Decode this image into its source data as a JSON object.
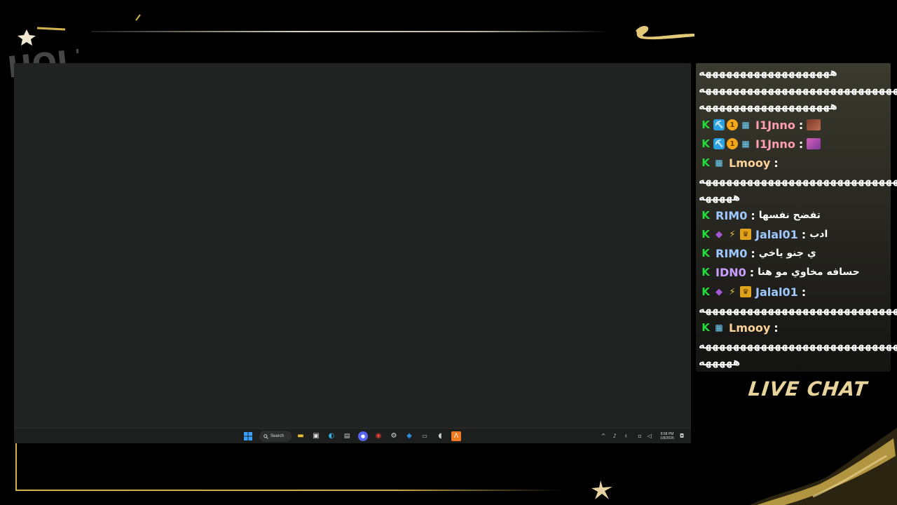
{
  "overlay": {
    "logo_text": "HOLZ",
    "live_chat_label": "LIVE CHAT",
    "accent_gold": "#d4b24e"
  },
  "taskbar": {
    "search_label": "Search",
    "clock_time": "8:58 PM",
    "clock_date": "1/8/2026",
    "lang": "ع",
    "icons": [
      "windows-start-icon",
      "search-icon",
      "file-explorer-icon",
      "store-icon",
      "edge-icon",
      "task-app-icon",
      "discord-icon",
      "chrome-icon",
      "steam-icon",
      "steam-blue-icon",
      "keyboard-icon",
      "app-icon",
      "orange-app-icon"
    ]
  },
  "chat": {
    "messages": [
      {
        "id": "m1",
        "lines": [
          "هههههههههههههههههههه",
          "هههههههههههههههههههههههههههههه",
          "هههههههههههههههههههه"
        ]
      },
      {
        "id": "m2",
        "user": "I1Jnno",
        "color": "#ff9fb0",
        "badges": [
          "kick",
          "pickaxe",
          "one",
          "og"
        ],
        "emote": "emote-brown"
      },
      {
        "id": "m3",
        "user": "I1Jnno",
        "color": "#ff9fb0",
        "badges": [
          "kick",
          "pickaxe",
          "one",
          "og"
        ],
        "emote": "emote-pink"
      },
      {
        "id": "m4",
        "user": "Lmooy",
        "color": "#ffd29a",
        "badges": [
          "kick",
          "og"
        ],
        "lines": [
          "هههههههههههههههههههههههههههههه",
          "هههههه"
        ]
      },
      {
        "id": "m5",
        "user": "RIM0",
        "color": "#9fc8ff",
        "badges": [
          "kick"
        ],
        "text": "تفضح نفسها"
      },
      {
        "id": "m6",
        "user": "Jalal01",
        "color": "#9fc8ff",
        "badges": [
          "kick",
          "cube",
          "bolt",
          "crown"
        ],
        "text": "ادب"
      },
      {
        "id": "m7",
        "user": "RIM0",
        "color": "#9fc8ff",
        "badges": [
          "kick"
        ],
        "text": "ي جنو ياخي"
      },
      {
        "id": "m8",
        "user": "IDN0",
        "color": "#c9a0ff",
        "badges": [
          "kick"
        ],
        "text": "حسافه مخاوي مو هنا"
      },
      {
        "id": "m9",
        "user": "Jalal01",
        "color": "#9fc8ff",
        "badges": [
          "kick",
          "cube",
          "bolt",
          "crown"
        ],
        "lines": [
          "هههههههههههههههههههههههههههههه"
        ]
      },
      {
        "id": "m10",
        "user": "Lmooy",
        "color": "#ffd29a",
        "badges": [
          "kick",
          "og"
        ],
        "lines": [
          "هههههههههههههههههههههههههههههه",
          "هههههه"
        ]
      }
    ]
  }
}
